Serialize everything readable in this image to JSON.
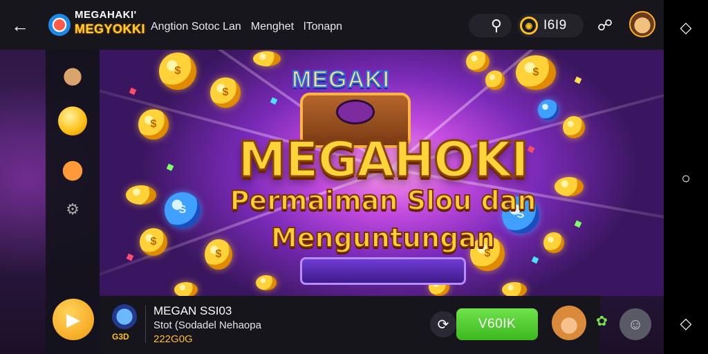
{
  "header": {
    "logo_line1": "MEGAHAKI'",
    "logo_line2": "MEGYOKKI",
    "nav": [
      "Angtion Sotoc Lan",
      "Menghet",
      "lTonapn"
    ],
    "coin_balance": "I6I9"
  },
  "banner": {
    "sub_logo": "MEGAKI",
    "title": "MEGAHOKI",
    "subtitle_line1": "Permaiman Slou dan",
    "subtitle_line2": "Menguntungan"
  },
  "game": {
    "name": "MEGAN SSI03",
    "description": "Stot (Sodadel Nehaopa",
    "number": "222G0G",
    "tag": "G3D",
    "play_label": "V60IK"
  },
  "icons": {
    "back": "back-arrow-icon",
    "search": "search-icon",
    "coin": "coin-icon",
    "chat": "chat-icon",
    "share": "share-icon",
    "play": "play-icon",
    "home": "home-icon",
    "nav_back": "nav-back-icon",
    "recent": "recent-apps-icon"
  },
  "colors": {
    "accent_gold": "#ffc21a",
    "play_green": "#4ccb2a",
    "banner_purple": "#c44be0"
  }
}
